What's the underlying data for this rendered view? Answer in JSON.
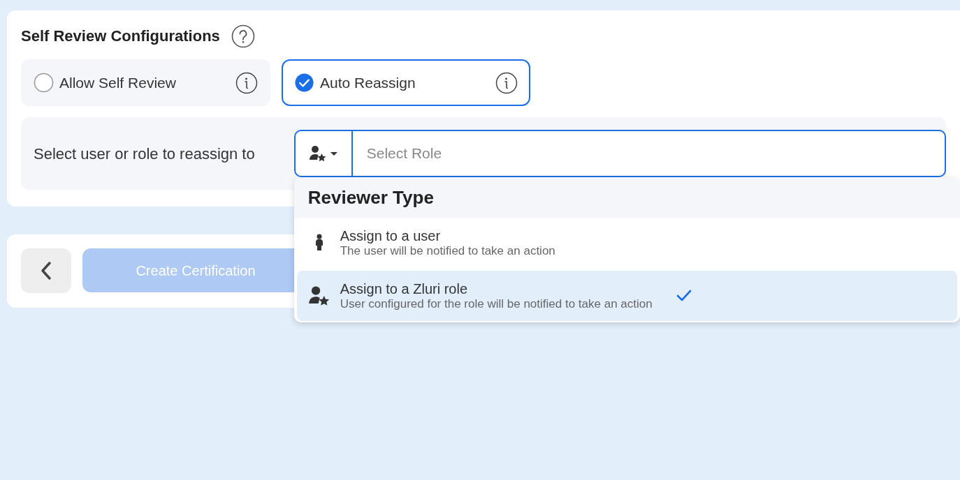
{
  "header": {
    "title": "Self Review Configurations"
  },
  "options": [
    {
      "label": "Allow Self Review",
      "checked": false
    },
    {
      "label": "Auto Reassign",
      "checked": true
    }
  ],
  "reassign": {
    "label": "Select user or role to reassign to",
    "picker": {
      "kind": "role"
    },
    "placeholder": "Select Role"
  },
  "dropdown": {
    "heading": "Reviewer Type",
    "items": [
      {
        "kind": "user",
        "title": "Assign to a user",
        "subtitle": "The user will be notified to take an action",
        "selected": false
      },
      {
        "kind": "role",
        "title": "Assign to a Zluri role",
        "subtitle": "User configured for the role will be notified to take an action",
        "selected": true
      }
    ]
  },
  "footer": {
    "primary_button": {
      "label": "Create Certification",
      "disabled": true
    }
  }
}
